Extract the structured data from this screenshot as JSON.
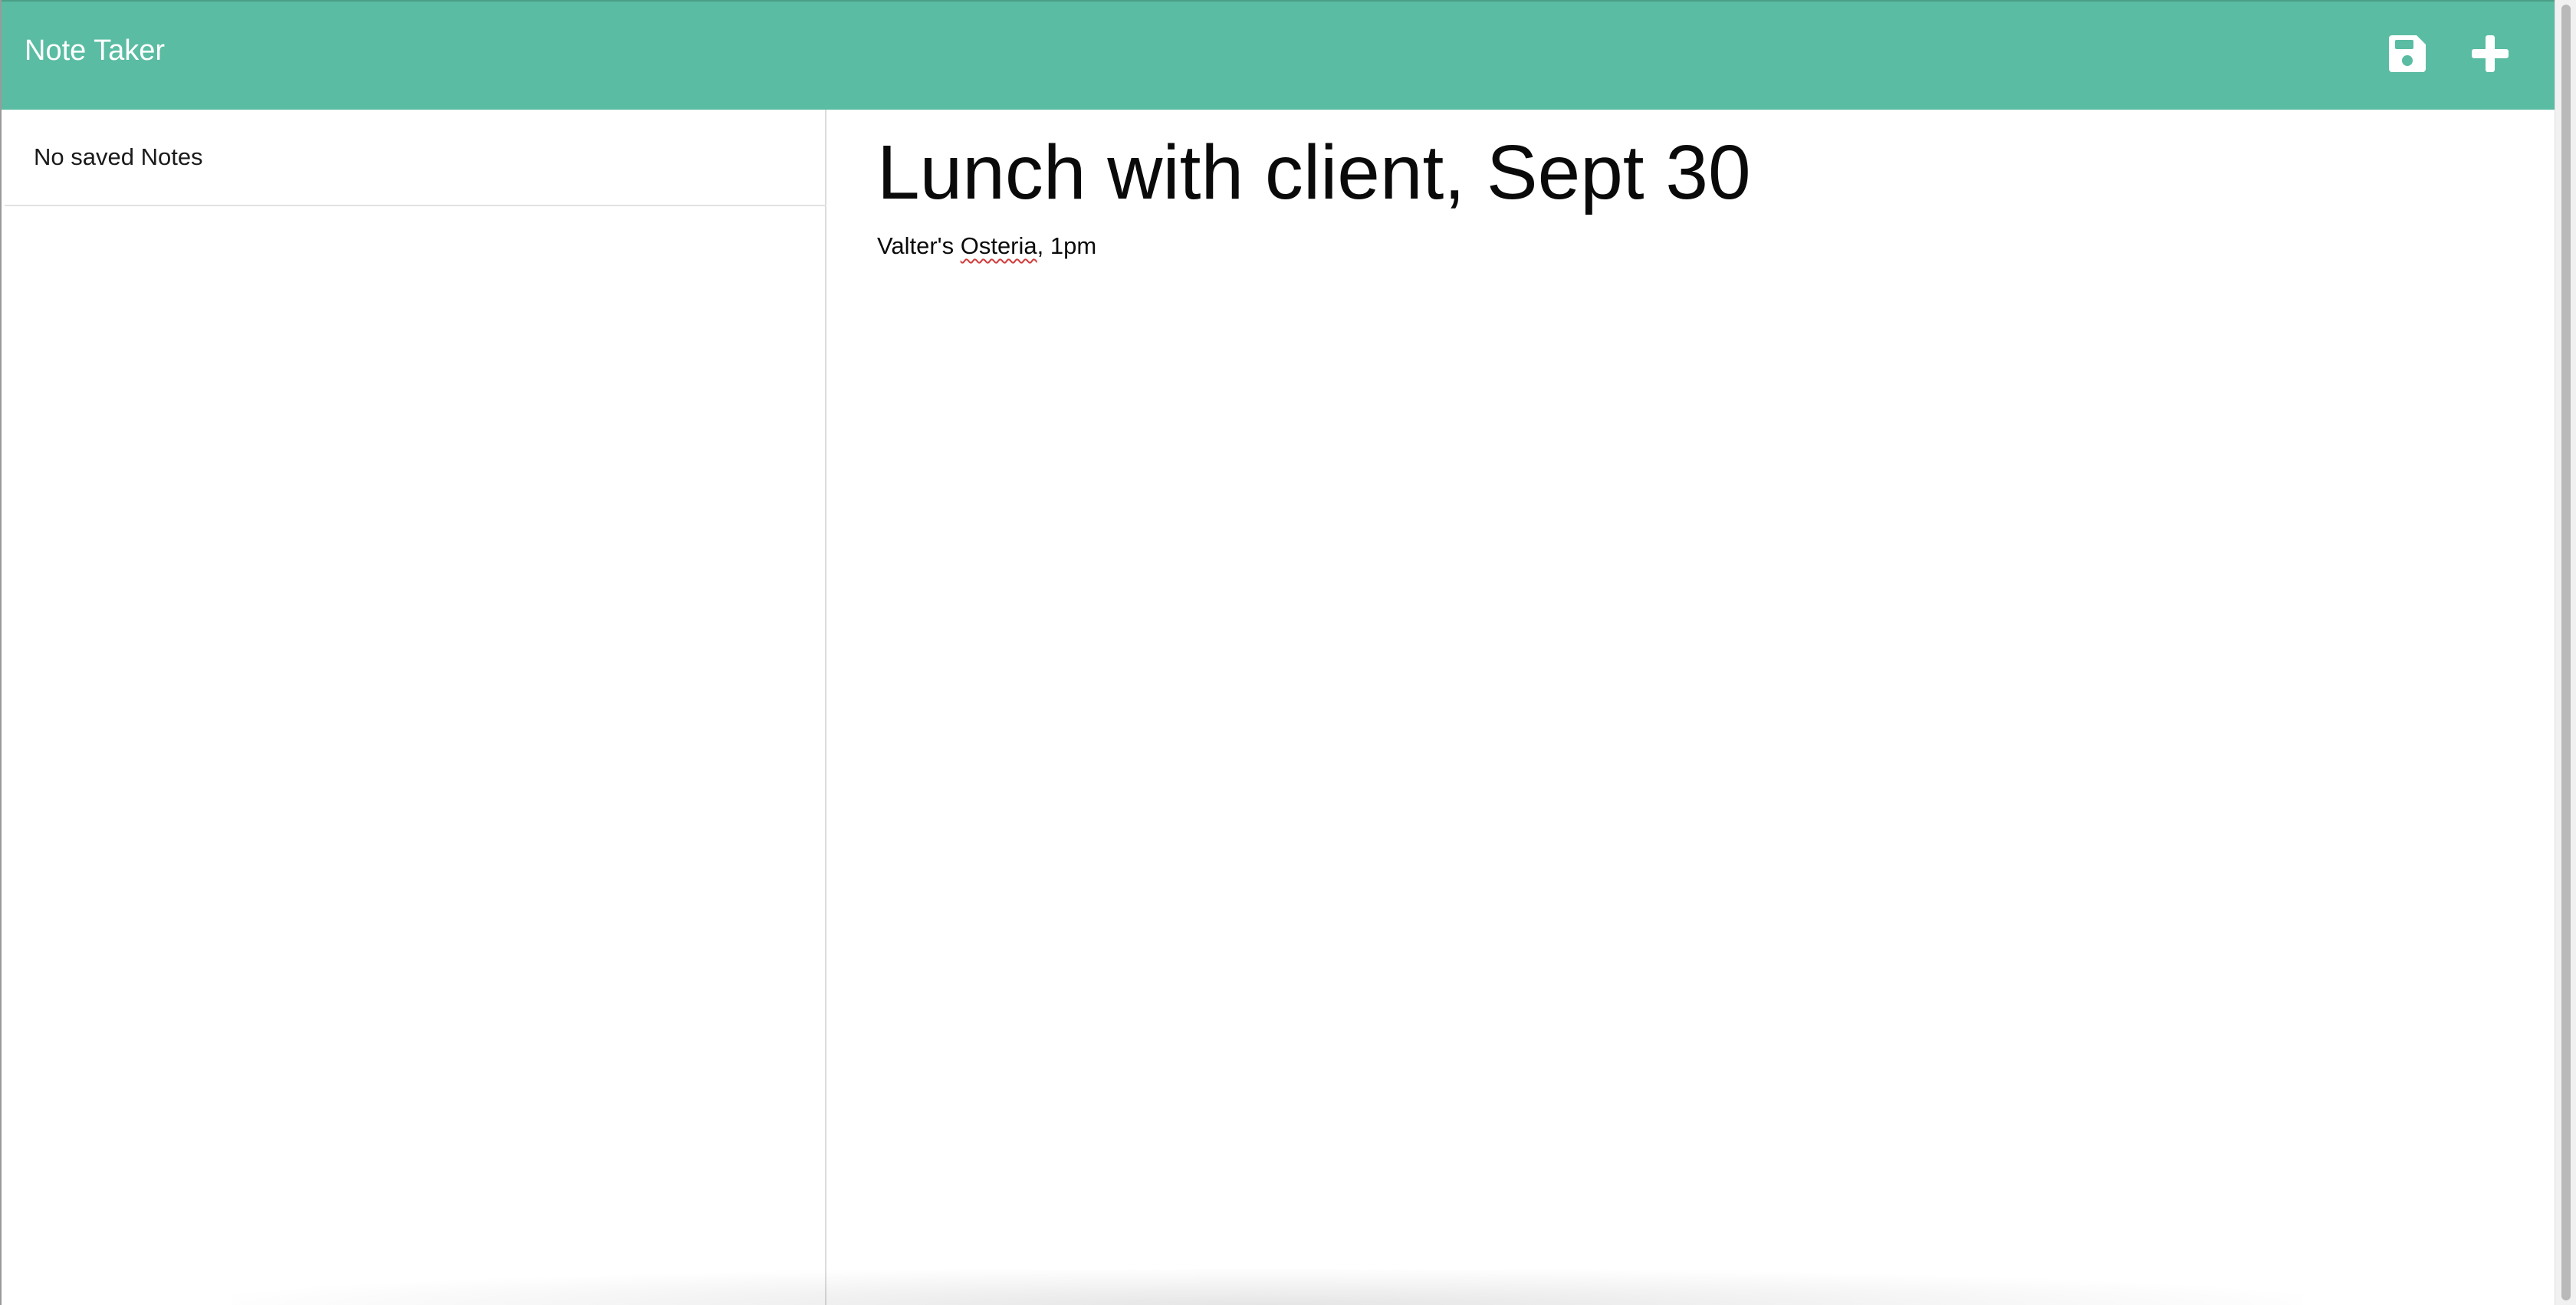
{
  "app": {
    "title": "Note Taker"
  },
  "toolbar": {
    "save_icon": "save-icon",
    "new_icon": "plus-icon"
  },
  "sidebar": {
    "items": [
      {
        "label": "No saved Notes"
      }
    ]
  },
  "note": {
    "title": "Lunch with client, Sept 30",
    "body_before": "Valter's ",
    "body_misspelled": "Osteria",
    "body_after": ", 1pm"
  },
  "colors": {
    "navbar": "#5abca2",
    "navbar_text": "#ffffff",
    "misspelling_underline": "#d23a3a"
  }
}
